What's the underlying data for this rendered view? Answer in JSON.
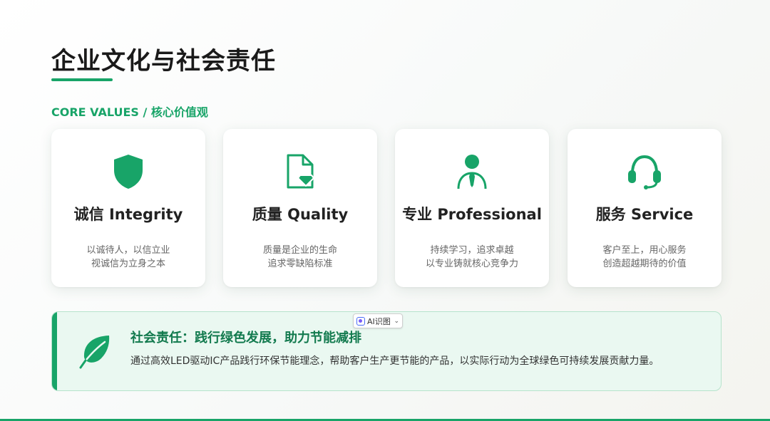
{
  "header": {
    "title": "企业文化与社会责任",
    "section_label": "CORE VALUES / 核心价值观"
  },
  "cards": [
    {
      "icon": "shield-icon",
      "title": "诚信 Integrity",
      "line1": "以诚待人，以信立业",
      "line2": "视诚信为立身之本"
    },
    {
      "icon": "document-diamond-icon",
      "title": "质量 Quality",
      "line1": "质量是企业的生命",
      "line2": "追求零缺陷标准"
    },
    {
      "icon": "professional-person-icon",
      "title": "专业 Professional",
      "line1": "持续学习，追求卓越",
      "line2": "以专业铸就核心竞争力"
    },
    {
      "icon": "headset-icon",
      "title": "服务 Service",
      "line1": "客户至上，用心服务",
      "line2": "创造超越期待的价值"
    }
  ],
  "csr": {
    "icon": "leaf-icon",
    "title": "社会责任：践行绿色发展，助力节能减排",
    "text": "通过高效LED驱动IC产品践行环保节能理念，帮助客户生产更节能的产品，以实际行动为全球绿色可持续发展贡献力量。"
  },
  "overlay": {
    "ai_chip_label": "AI识图"
  },
  "colors": {
    "accent": "#18a468",
    "csr_background": "#eaf8f1"
  }
}
